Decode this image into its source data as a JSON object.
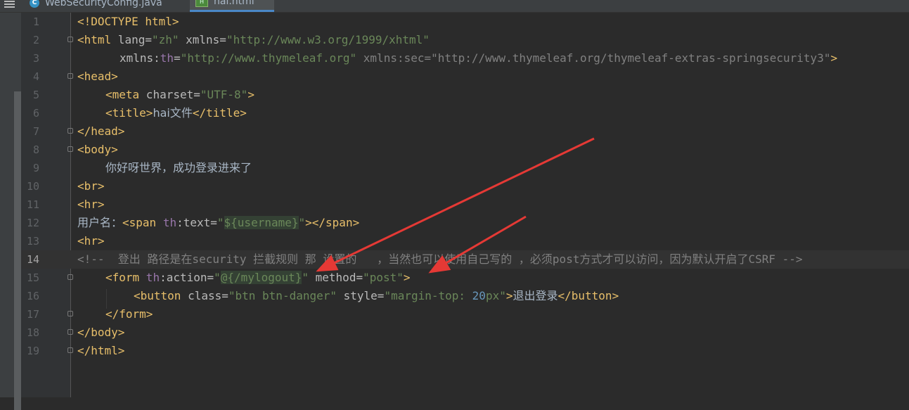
{
  "tabs": [
    {
      "label": "WebSecurityConfig.java",
      "icon": "java-class-icon",
      "active": false
    },
    {
      "label": "hai.html",
      "icon": "html-file-icon",
      "active": true
    }
  ],
  "editor": {
    "current_line": 14,
    "lines": [
      {
        "n": "1"
      },
      {
        "n": "2"
      },
      {
        "n": "3"
      },
      {
        "n": "4"
      },
      {
        "n": "5"
      },
      {
        "n": "6"
      },
      {
        "n": "7"
      },
      {
        "n": "8"
      },
      {
        "n": "9"
      },
      {
        "n": "10"
      },
      {
        "n": "11"
      },
      {
        "n": "12"
      },
      {
        "n": "13"
      },
      {
        "n": "14"
      },
      {
        "n": "15"
      },
      {
        "n": "16"
      },
      {
        "n": "17"
      },
      {
        "n": "18"
      },
      {
        "n": "19"
      }
    ],
    "code": {
      "l1_doctype": "<!DOCTYPE html>",
      "l2_html_open": "<html",
      "l2_lang_attr": " lang=",
      "l2_lang_val": "\"zh\"",
      "l2_xmlns_attr": " xmlns=",
      "l2_xmlns_val": "\"http://www.w3.org/1999/xhtml\"",
      "l3_xmlns": "xmlns:",
      "l3_th": "th",
      "l3_eq": "=",
      "l3_th_val": "\"http://www.thymeleaf.org\"",
      "l3_sec": " xmlns:sec=\"http://www.thymeleaf.org/thymeleaf-extras-springsecurity3\"",
      "l3_close": ">",
      "l4": "<head>",
      "l5_meta": "<meta",
      "l5_attr": " charset=",
      "l5_val": "\"UTF-8\"",
      "l5_close": ">",
      "l6_open": "<title>",
      "l6_text": "hai文件",
      "l6_close": "</title>",
      "l7": "</head>",
      "l8": "<body>",
      "l9_text": "你好呀世界，成功登录进来了",
      "l10": "<br>",
      "l11": "<hr>",
      "l12_label": "用户名：",
      "l12_span": "<span",
      "l12_th": " th",
      "l12_attr": ":text=",
      "l12_q1": "\"",
      "l12_expr": "${username}",
      "l12_q2": "\"",
      "l12_close": "></span>",
      "l13": "<hr>",
      "l14_comment": "<!--  登出 路径是在security 拦截规则 那 设置的   ，当然也可以使用自己写的 ，必须post方式才可以访问，因为默认开启了CSRF -->",
      "l15_form": "<form",
      "l15_th": " th",
      "l15_attr": ":action=",
      "l15_q1": "\"",
      "l15_expr": "@{/mylogout}",
      "l15_q2": "\"",
      "l15_method_attr": " method=",
      "l15_method_val": "\"post\"",
      "l15_close": ">",
      "l16_btn": "<button",
      "l16_class_attr": " class=",
      "l16_class_val": "\"btn btn-danger\"",
      "l16_style_attr": " style=",
      "l16_style_a": "\"margin-top: ",
      "l16_style_num": "20",
      "l16_style_b": "px\"",
      "l16_gt": ">",
      "l16_text": "退出登录",
      "l16_close": "</button>",
      "l17": "</form>",
      "l18": "</body>",
      "l19": "</html>"
    }
  },
  "colors": {
    "tag": "#e8bf6a",
    "string": "#6a8759",
    "comment": "#808080",
    "namespace": "#9876aa",
    "arrow": "#e53935"
  }
}
